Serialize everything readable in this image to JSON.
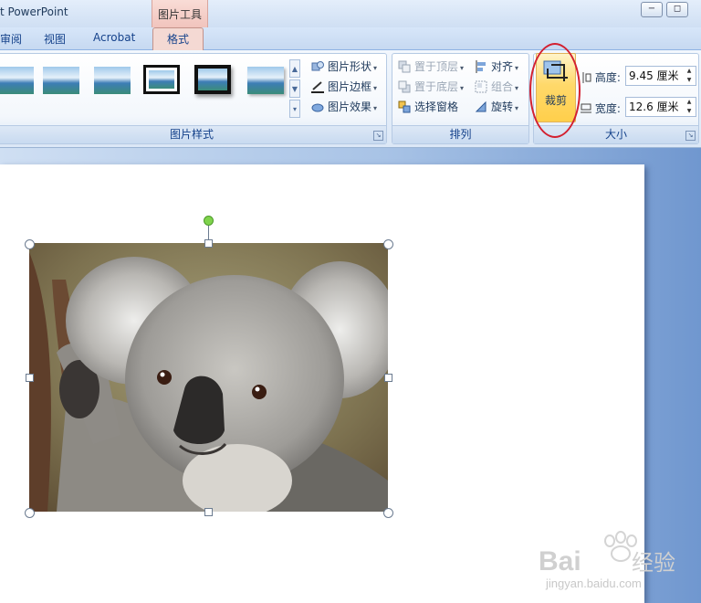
{
  "window": {
    "title": "t PowerPoint",
    "context_tab": "图片工具"
  },
  "window_controls": {
    "minimize": "−",
    "restore": "◻"
  },
  "tabs": [
    {
      "label": "审阅"
    },
    {
      "label": "视图"
    },
    {
      "label": "Acrobat"
    },
    {
      "label": "格式",
      "selected": true
    }
  ],
  "picture_styles": {
    "group_label": "图片样式",
    "commands": [
      {
        "label": "图片形状"
      },
      {
        "label": "图片边框"
      },
      {
        "label": "图片效果"
      }
    ]
  },
  "arrange": {
    "group_label": "排列",
    "commands": [
      {
        "label": "置于顶层",
        "enabled": false
      },
      {
        "label": "置于底层",
        "enabled": false
      },
      {
        "label": "选择窗格",
        "enabled": true
      },
      {
        "label": "对齐",
        "enabled": true
      },
      {
        "label": "组合",
        "enabled": false
      },
      {
        "label": "旋转",
        "enabled": true
      }
    ]
  },
  "size": {
    "group_label": "大小",
    "crop_label": "裁剪",
    "height_label": "高度:",
    "height_value": "9.45 厘米",
    "width_label": "宽度:",
    "width_value": "12.6 厘米"
  },
  "slide_image": {
    "subject": "koala"
  },
  "watermark": {
    "brand": "Baidu经验",
    "url": "jingyan.baidu.com"
  },
  "colors": {
    "accent_tab": "#f4d9d3",
    "crop_highlight": "#d32030",
    "ribbon_text": "#15428b"
  }
}
